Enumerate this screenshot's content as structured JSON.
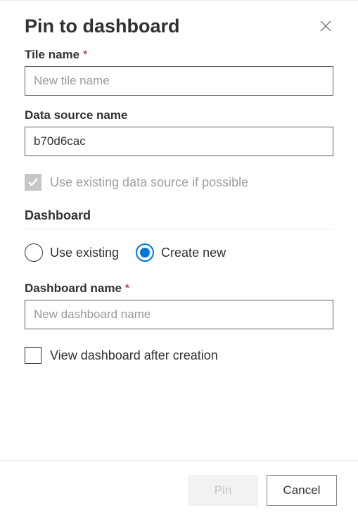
{
  "header": {
    "title": "Pin to dashboard"
  },
  "tile_name": {
    "label": "Tile name",
    "required": "*",
    "placeholder": "New tile name",
    "value": ""
  },
  "data_source": {
    "label": "Data source name",
    "value": "b70d6cac"
  },
  "use_existing_source": {
    "label": "Use existing data source if possible"
  },
  "dashboard_section": {
    "label": "Dashboard"
  },
  "radio_options": {
    "use_existing": "Use existing",
    "create_new": "Create new"
  },
  "dashboard_name": {
    "label": "Dashboard name",
    "required": "*",
    "placeholder": "New dashboard name",
    "value": ""
  },
  "view_after": {
    "label": "View dashboard after creation"
  },
  "footer": {
    "pin": "Pin",
    "cancel": "Cancel"
  }
}
